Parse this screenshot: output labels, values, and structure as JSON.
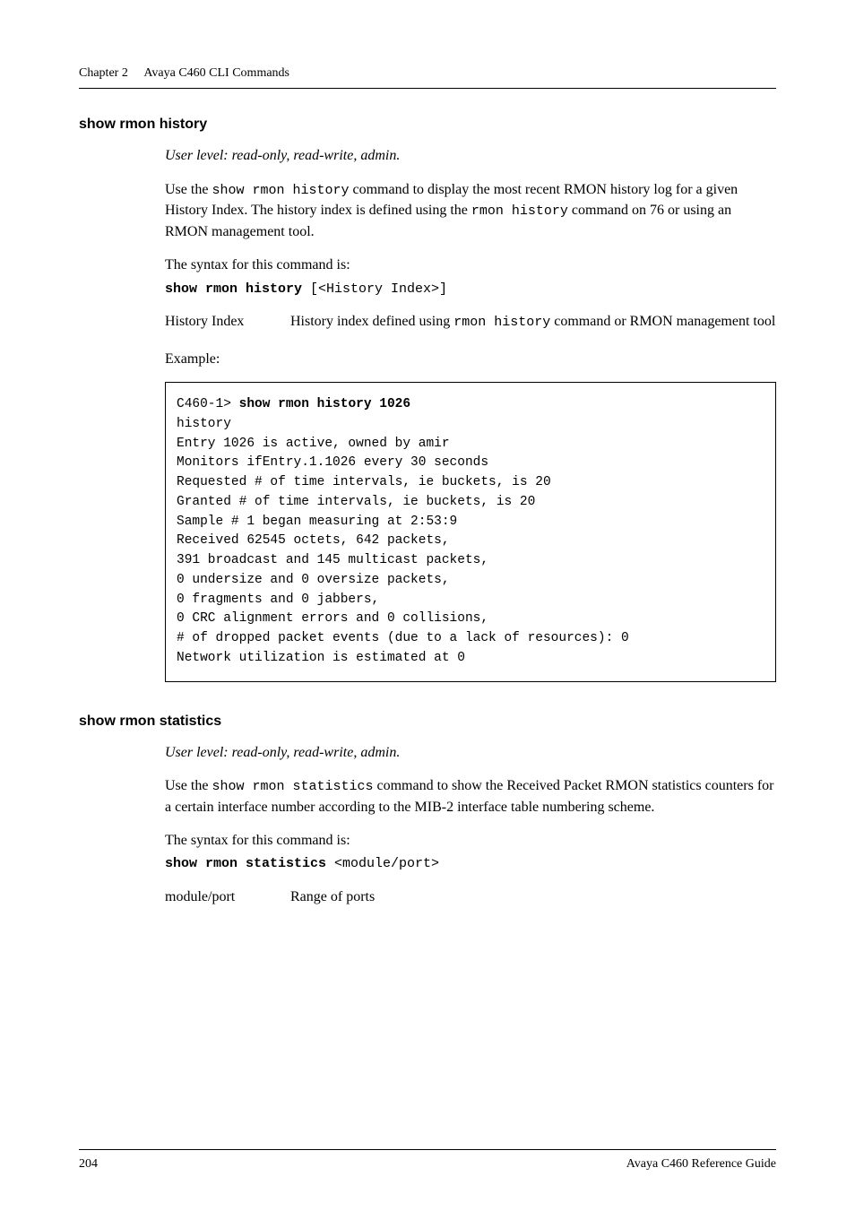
{
  "header": {
    "chapter": "Chapter 2",
    "title": "Avaya C460 CLI Commands"
  },
  "section1": {
    "title": "show rmon history",
    "userlevel": "User level: read-only, read-write, admin.",
    "body_pre": "Use the ",
    "cmd1": "show rmon history",
    "body_mid1": " command to display the most recent RMON history log for a given History Index. The history index is defined using the  ",
    "cmd2": "rmon history",
    "body_mid2": "  command on  76 or using an RMON management tool.",
    "syntax_intro": "The syntax for this command is:",
    "syntax_bold": "show rmon history",
    "syntax_rest": " [<History Index>]",
    "param_name": "History Index",
    "param_desc_pre": "History index defined using ",
    "param_desc_code": "rmon history",
    "param_desc_post": " command or RMON management tool",
    "example_label": "Example:",
    "code_prompt": "C460-1> ",
    "code_cmd": "show rmon history 1026",
    "code_body": "history\nEntry 1026 is active, owned by amir\nMonitors ifEntry.1.1026 every 30 seconds\nRequested # of time intervals, ie buckets, is 20\nGranted # of time intervals, ie buckets, is 20\nSample # 1 began measuring at 2:53:9\nReceived 62545 octets, 642 packets,\n391 broadcast and 145 multicast packets,\n0 undersize and 0 oversize packets,\n0 fragments and 0 jabbers,\n0 CRC alignment errors and 0 collisions,\n# of dropped packet events (due to a lack of resources): 0\nNetwork utilization is estimated at 0"
  },
  "section2": {
    "title": "show rmon statistics",
    "userlevel": "User level: read-only, read-write, admin.",
    "body_pre": "Use the ",
    "cmd1": "show rmon statistics",
    "body_mid1": " command to show the Received Packet RMON statistics counters for a certain interface number according to the MIB-2 interface table numbering scheme.",
    "syntax_intro": "The syntax for this command is:",
    "syntax_bold": "show rmon statistics",
    "syntax_rest": " <module/port>",
    "param_name": "module/port",
    "param_desc": "Range of ports"
  },
  "footer": {
    "page": "204",
    "doc": "Avaya C460 Reference Guide"
  }
}
